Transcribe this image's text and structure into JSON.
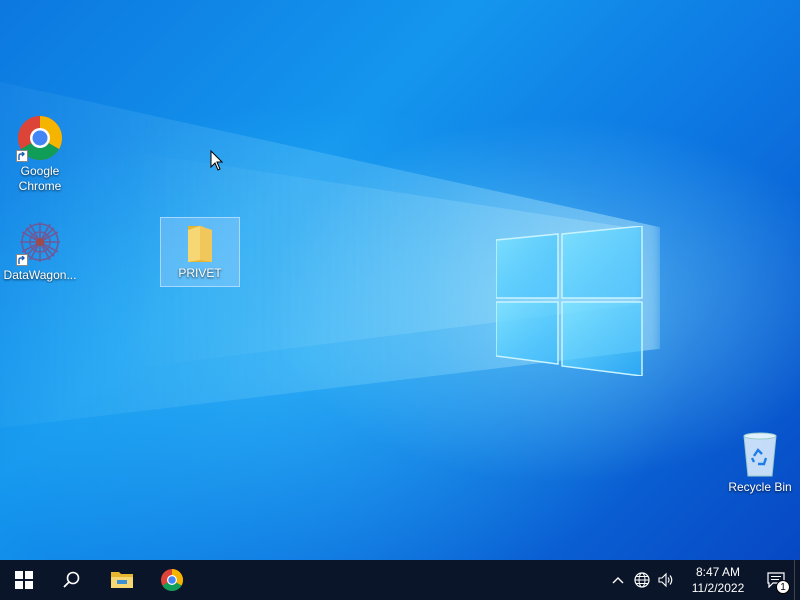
{
  "desktop": {
    "icons": [
      {
        "label": "Google Chrome",
        "icon": "chrome-icon",
        "shortcut": true
      },
      {
        "label": "DataWagon...",
        "icon": "datawagon-icon",
        "shortcut": true
      },
      {
        "label": "PRIVET",
        "icon": "folder-icon",
        "selected": true
      },
      {
        "label": "Recycle Bin",
        "icon": "recycle-bin-icon"
      }
    ]
  },
  "taskbar": {
    "start": "windows-start-icon",
    "search": "search-icon",
    "pinned": [
      "file-explorer-icon",
      "chrome-icon"
    ],
    "tray": {
      "icons": [
        "chevron-up-icon",
        "network-globe-icon",
        "volume-icon"
      ],
      "time": "8:47 AM",
      "date": "11/2/2022",
      "notifications": "1"
    }
  },
  "colors": {
    "taskbar": "#0b1529",
    "desktop_accent": "#0c78e0"
  }
}
